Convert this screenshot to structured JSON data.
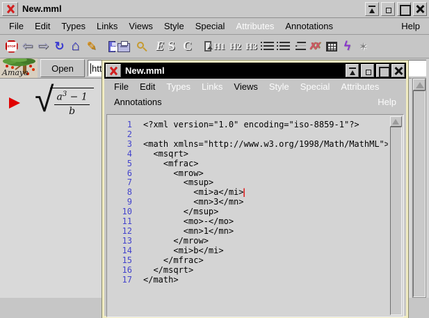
{
  "colors": {
    "accent_red": "#d22020",
    "line_number_blue": "#4444cc",
    "window_border_cream": "#f1ecc2",
    "source_titlebar": "#000000",
    "chrome_gray": "#c6c6c6"
  },
  "window_buttons": [
    {
      "name": "shade-button",
      "cls": "wb-shade"
    },
    {
      "name": "iconify-button",
      "cls": "wb-iconify"
    },
    {
      "name": "maximize-button",
      "cls": "wb-maximize"
    },
    {
      "name": "close-button",
      "cls": "wb-close"
    }
  ],
  "main_window": {
    "title": "New.mml",
    "logo_text": "Amaya",
    "menubar": {
      "items": [
        {
          "label": "File"
        },
        {
          "label": "Edit"
        },
        {
          "label": "Types"
        },
        {
          "label": "Links"
        },
        {
          "label": "Views"
        },
        {
          "label": "Style"
        },
        {
          "label": "Special"
        },
        {
          "label": "Attributes",
          "cls": "disabled"
        },
        {
          "label": "Annotations"
        }
      ],
      "help_label": "Help"
    },
    "toolbar": {
      "icons": [
        {
          "name": "stop-icon",
          "glyph": "STOP",
          "cls": "tb-stop"
        },
        {
          "name": "back-icon",
          "glyph": "⇦",
          "cls": "tb-arrow"
        },
        {
          "name": "forward-icon",
          "glyph": "⇨",
          "cls": "tb-arrow"
        },
        {
          "name": "reload-icon",
          "glyph": "↻",
          "cls": "tb-reload"
        },
        {
          "name": "home-icon",
          "glyph": "⌂",
          "cls": "tb-home"
        },
        {
          "name": "pencil-icon",
          "glyph": "✎",
          "cls": "tb-pencil"
        },
        {
          "name": "save-icon",
          "glyph": "",
          "cls": "tb-save gap"
        },
        {
          "name": "print-icon",
          "glyph": "",
          "cls": "tb-print"
        },
        {
          "name": "search-icon",
          "glyph": "",
          "cls": "tb-find"
        },
        {
          "name": "emphasis-icon",
          "glyph": "E",
          "cls": "tb-letter italic gap"
        },
        {
          "name": "strong-icon",
          "glyph": "S",
          "cls": "tb-letter"
        },
        {
          "name": "code-icon",
          "glyph": "C",
          "cls": "tb-letter"
        },
        {
          "name": "image-icon",
          "glyph": "",
          "cls": "tb-image gap"
        },
        {
          "name": "h1-icon",
          "glyph": "H1",
          "cls": "tb-h"
        },
        {
          "name": "h2-icon",
          "glyph": "H2",
          "cls": "tb-h"
        },
        {
          "name": "h3-icon",
          "glyph": "H3",
          "cls": "tb-h"
        },
        {
          "name": "bullet-list-icon",
          "glyph": "",
          "cls": "tb-ul"
        },
        {
          "name": "numbered-list-icon",
          "glyph": "",
          "cls": "tb-ol"
        },
        {
          "name": "definition-list-icon",
          "glyph": "",
          "cls": "tb-dl"
        },
        {
          "name": "delete-icon",
          "glyph": "✗✗",
          "cls": "tb-del"
        },
        {
          "name": "table-icon",
          "glyph": "",
          "cls": "tb-table"
        },
        {
          "name": "math-icon",
          "glyph": "ϟ",
          "cls": "tb-math"
        },
        {
          "name": "link-icon",
          "glyph": "✶",
          "cls": "tb-link"
        }
      ]
    },
    "address_bar": {
      "open_label": "Open",
      "url_value": "http"
    },
    "document": {
      "formula": {
        "radical": "√",
        "base": "a",
        "exponent": "3",
        "operator": "−",
        "operand": "1",
        "denominator": "b"
      }
    }
  },
  "source_window": {
    "title": "New.mml",
    "menubar": {
      "row1": [
        {
          "label": "File"
        },
        {
          "label": "Edit"
        },
        {
          "label": "Types",
          "cls": "disabled"
        },
        {
          "label": "Links",
          "cls": "disabled"
        },
        {
          "label": "Views"
        },
        {
          "label": "Style",
          "cls": "disabled"
        },
        {
          "label": "Special",
          "cls": "disabled"
        },
        {
          "label": "Attributes",
          "cls": "disabled"
        }
      ],
      "row2_left": "Annotations",
      "row2_right": "Help"
    },
    "code": {
      "lines": [
        {
          "num": "1",
          "text": "<?xml version=\"1.0\" encoding=\"iso-8859-1\"?>"
        },
        {
          "num": "2",
          "text": ""
        },
        {
          "num": "3",
          "text": "<math xmlns=\"http://www.w3.org/1998/Math/MathML\">"
        },
        {
          "num": "4",
          "text": "  <msqrt>"
        },
        {
          "num": "5",
          "text": "    <mfrac>"
        },
        {
          "num": "6",
          "text": "      <mrow>"
        },
        {
          "num": "7",
          "text": "        <msup>"
        },
        {
          "num": "8",
          "text": "          <mi>a</mi>",
          "caret": "|"
        },
        {
          "num": "9",
          "text": "          <mn>3</mn>"
        },
        {
          "num": "10",
          "text": "        </msup>"
        },
        {
          "num": "11",
          "text": "        <mo>-</mo>"
        },
        {
          "num": "12",
          "text": "        <mn>1</mn>"
        },
        {
          "num": "13",
          "text": "      </mrow>"
        },
        {
          "num": "14",
          "text": "      <mi>b</mi>"
        },
        {
          "num": "15",
          "text": "    </mfrac>"
        },
        {
          "num": "16",
          "text": "  </msqrt>"
        },
        {
          "num": "17",
          "text": "</math>"
        }
      ]
    }
  }
}
